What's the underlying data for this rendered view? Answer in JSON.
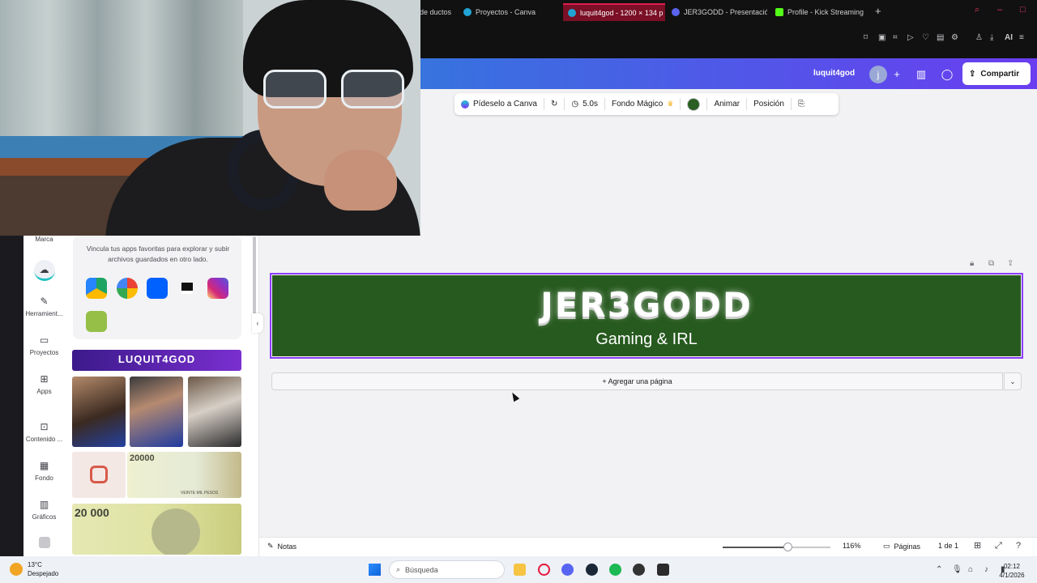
{
  "browser": {
    "tabs": [
      {
        "label": "de ductos",
        "active": false
      },
      {
        "label": "Proyectos - Canva",
        "active": false
      },
      {
        "label": "luquit4god - 1200 × 134 p",
        "active": true
      },
      {
        "label": "JER3GODD - Presentación",
        "active": false
      },
      {
        "label": "Profile - Kick Streaming",
        "active": false
      }
    ],
    "toolbar_ai_label": "AI"
  },
  "canva_header": {
    "user_name": "luquit4god",
    "avatar_initial": "j",
    "share_label": "Compartir"
  },
  "context_toolbar": {
    "ask_canva": "Pídeselo a Canva",
    "duration": "5.0s",
    "magic_bg": "Fondo Mágico",
    "color_swatch": "#2a5e23",
    "animate": "Animar",
    "position": "Posición"
  },
  "rail": {
    "items": [
      {
        "label": "Marca",
        "icon": "brand-icon"
      },
      {
        "label": "",
        "icon": "cloud-upload-icon"
      },
      {
        "label": "Herramient...",
        "icon": "pen-icon"
      },
      {
        "label": "Proyectos",
        "icon": "folder-icon"
      },
      {
        "label": "Apps",
        "icon": "apps-icon"
      },
      {
        "label": "Contenido ...",
        "icon": "content-icon"
      },
      {
        "label": "Fondo",
        "icon": "pattern-icon"
      },
      {
        "label": "Gráficos",
        "icon": "chart-icon"
      }
    ]
  },
  "panel": {
    "connect_text": "Vincula tus apps favoritas para explorar y subir archivos guardados en otro lado.",
    "apps": [
      "google-drive-icon",
      "google-photos-icon",
      "dropbox-icon",
      "capcut-icon",
      "instagram-icon",
      "shopify-icon"
    ],
    "banner_title": "LUQUIT4GOD",
    "note_value_1": "20000",
    "note_value_2": "20 000",
    "note_caption": "VEINTE MIL PESOS"
  },
  "design": {
    "title": "JER3GODD",
    "subtitle": "Gaming & IRL",
    "background": "#275a1f"
  },
  "canvas": {
    "add_page": "+ Agregar una página"
  },
  "footer": {
    "notes": "Notas",
    "zoom": "116%",
    "zoom_level": 0.6,
    "pages": "Páginas",
    "page_count": "1 de 1"
  },
  "taskbar": {
    "temperature": "13°C",
    "weather": "Despejado",
    "weather_badge": "3",
    "search_placeholder": "Búsqueda",
    "time": "02:12",
    "date": "4/1/2026"
  },
  "colors": {
    "accent": "#8b3dff",
    "brand_gradient_start": "#1fa0c9",
    "brand_gradient_end": "#6a3df0"
  }
}
